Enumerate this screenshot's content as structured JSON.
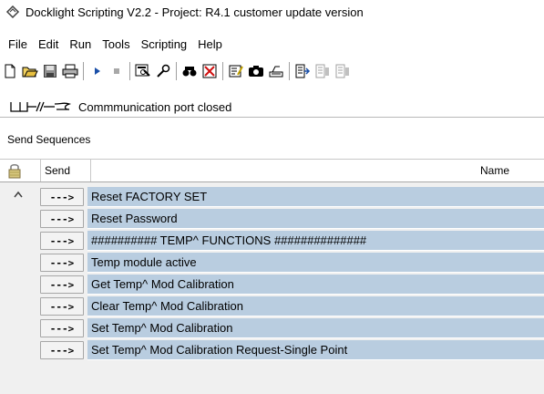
{
  "window": {
    "title": "Docklight Scripting V2.2 - Project: R4.1 customer update version"
  },
  "menubar": {
    "items": [
      "File",
      "Edit",
      "Run",
      "Tools",
      "Scripting",
      "Help"
    ]
  },
  "status": {
    "text": "Commmunication port closed"
  },
  "send_sequences": {
    "label": "Send Sequences",
    "columns": {
      "send": "Send",
      "name": "Name"
    },
    "rows": [
      {
        "button": "--->",
        "name": "Reset FACTORY SET"
      },
      {
        "button": "--->",
        "name": "Reset Password"
      },
      {
        "button": "--->",
        "name": "########## TEMP^ FUNCTIONS ##############"
      },
      {
        "button": "--->",
        "name": "Temp module active"
      },
      {
        "button": "--->",
        "name": "Get Temp^ Mod Calibration"
      },
      {
        "button": "--->",
        "name": "Clear Temp^ Mod Calibration"
      },
      {
        "button": "--->",
        "name": "Set Temp^ Mod Calibration"
      },
      {
        "button": "--->",
        "name": "Set Temp^ Mod Calibration Request-Single Point"
      }
    ]
  },
  "colors": {
    "row_highlight": "#b9cde0",
    "play_icon": "#1a4fa8"
  },
  "toolbar_icons": [
    "new-file-icon",
    "open-folder-icon",
    "save-disk-icon",
    "print-icon",
    "run-icon",
    "stop-icon",
    "settings-icon",
    "wrench-icon",
    "find-icon",
    "clear-icon",
    "edit-script-icon",
    "snapshot-icon",
    "keyboard-icon",
    "send-doc-icon",
    "doc-icon-2",
    "doc-icon-3"
  ]
}
